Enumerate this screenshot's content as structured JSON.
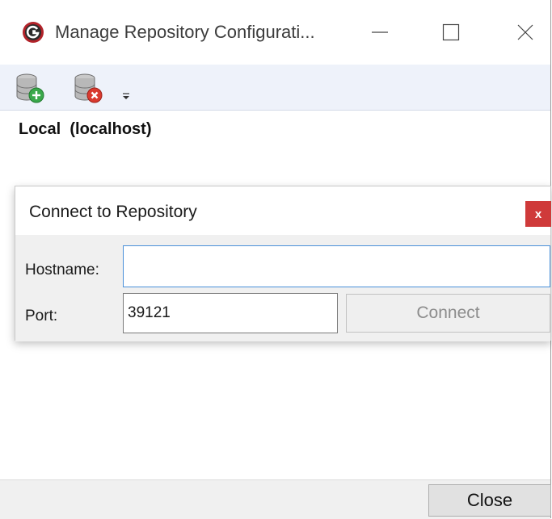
{
  "window": {
    "title": "Manage Repository Configurati..."
  },
  "titlebar": {
    "minimize_icon": "minimize-icon",
    "maximize_icon": "maximize-icon",
    "close_icon": "close-icon"
  },
  "toolbar": {
    "add_repository_icon": "database-add-icon",
    "remove_repository_icon": "database-remove-icon",
    "overflow_icon": "overflow-chevron-icon"
  },
  "repositories": [
    {
      "name": "Local",
      "host": "(localhost)"
    }
  ],
  "connect_dialog": {
    "title": "Connect to Repository",
    "close_label": "x",
    "hostname_label": "Hostname:",
    "hostname_value": "",
    "port_label": "Port:",
    "port_value": "39121",
    "connect_label": "Connect"
  },
  "footer": {
    "close_label": "Close"
  },
  "colors": {
    "toolbar_bg": "#eef2fa",
    "dialog_close_bg": "#cf3a3a",
    "input_focus_border": "#4a90d9",
    "app_icon": "#b2232a"
  }
}
